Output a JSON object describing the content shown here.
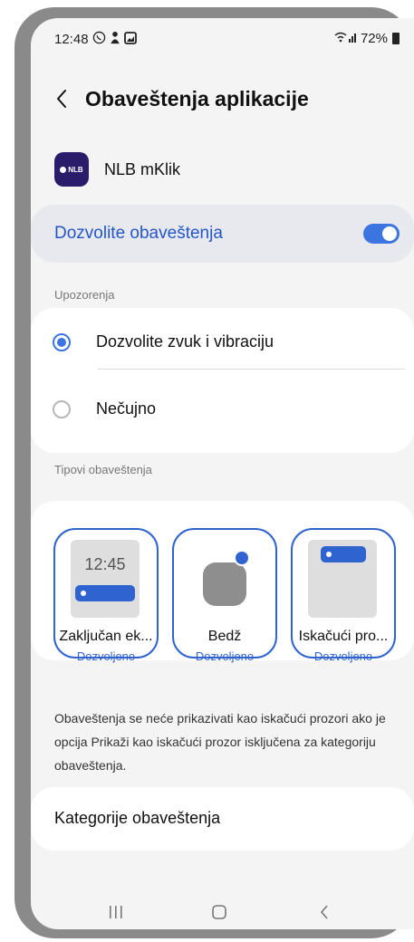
{
  "status_bar": {
    "time": "12:48",
    "icons": [
      "whatsapp-icon",
      "person-icon",
      "image-icon"
    ],
    "signal_text": "☲ıl",
    "battery_text": "72%"
  },
  "header": {
    "title": "Obaveštenja aplikacije"
  },
  "app": {
    "name": "NLB mKlik",
    "logo_text": "NLB"
  },
  "allow_notifications": {
    "label": "Dozvolite obaveštenja",
    "enabled": true
  },
  "alerts": {
    "section_label": "Upozorenja",
    "options": [
      {
        "label": "Dozvolite zvuk i vibraciju",
        "selected": true
      },
      {
        "label": "Nečujno",
        "selected": false
      }
    ]
  },
  "notification_types": {
    "section_label": "Tipovi obaveštenja",
    "tiles": [
      {
        "name": "Zaključan ek...",
        "status": "Dozvoljeno",
        "preview_time": "12:45"
      },
      {
        "name": "Bedž",
        "status": "Dozvoljeno"
      },
      {
        "name": "Iskačući pro...",
        "status": "Dozvoljeno"
      }
    ]
  },
  "info_text": "Obaveštenja se neće prikazivati kao iskačući prozori ako je opcija Prikaži kao iskačući prozor isključena za kategoriju obaveštenja.",
  "categories": {
    "label": "Kategorije obaveštenja"
  },
  "colors": {
    "accent": "#2f63cf",
    "toggle": "#3d75e0",
    "allow_text": "#2356c9"
  }
}
